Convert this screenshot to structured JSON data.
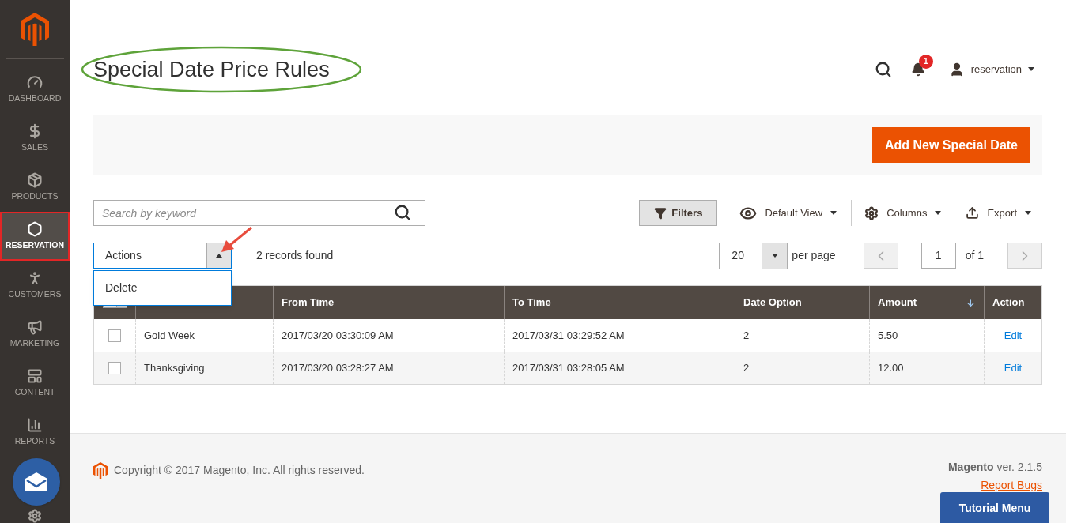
{
  "sidebar": {
    "items": [
      {
        "kind": "dashboard",
        "label": "DASHBOARD",
        "selected": false
      },
      {
        "kind": "sales",
        "label": "SALES",
        "selected": false
      },
      {
        "kind": "products",
        "label": "PRODUCTS",
        "selected": false
      },
      {
        "kind": "reservation",
        "label": "RESERVATION",
        "selected": true
      },
      {
        "kind": "customers",
        "label": "CUSTOMERS",
        "selected": false
      },
      {
        "kind": "marketing",
        "label": "MARKETING",
        "selected": false
      },
      {
        "kind": "content",
        "label": "CONTENT",
        "selected": false
      },
      {
        "kind": "reports",
        "label": "REPORTS",
        "selected": false
      }
    ]
  },
  "header": {
    "title": "Special Date Price Rules",
    "notifications": "1",
    "user": "reservation"
  },
  "page_actions": {
    "button": "Add New Special Date"
  },
  "search": {
    "placeholder": "Search by keyword"
  },
  "toolbar": {
    "filters": "Filters",
    "view": "Default View",
    "columns": "Columns",
    "export": "Export"
  },
  "actions": {
    "label": "Actions",
    "expanded": true,
    "options": [
      "Delete"
    ]
  },
  "records": "2 records found",
  "pagination": {
    "per_page": "20",
    "per_page_label": "per page",
    "page": "1",
    "of": "of 1"
  },
  "table": {
    "columns": [
      {
        "sorted": false
      },
      {
        "label": "From Time",
        "sorted": false
      },
      {
        "label": "To Time",
        "sorted": false
      },
      {
        "label": "Date Option",
        "sorted": false
      },
      {
        "label": "Amount",
        "sorted": true
      },
      {
        "label": "Action",
        "sorted": false
      }
    ],
    "mass_select": {
      "checked": false
    },
    "rows": [
      {
        "checked": false,
        "cells": [
          "Gold Week",
          "2017/03/20 03:30:09 AM",
          "2017/03/31 03:29:52 AM",
          "2",
          "5.50"
        ],
        "action": "Edit"
      },
      {
        "checked": false,
        "cells": [
          "Thanksgiving",
          "2017/03/20 03:28:27 AM",
          "2017/03/31 03:28:05 AM",
          "2",
          "12.00"
        ],
        "action": "Edit"
      }
    ]
  },
  "footer": {
    "copyright": "Copyright © 2017 Magento, Inc. All rights reserved.",
    "version": "**Magento** ver. 2.1.5",
    "report_bugs": "Report Bugs"
  },
  "tutorial_button": "Tutorial Menu"
}
